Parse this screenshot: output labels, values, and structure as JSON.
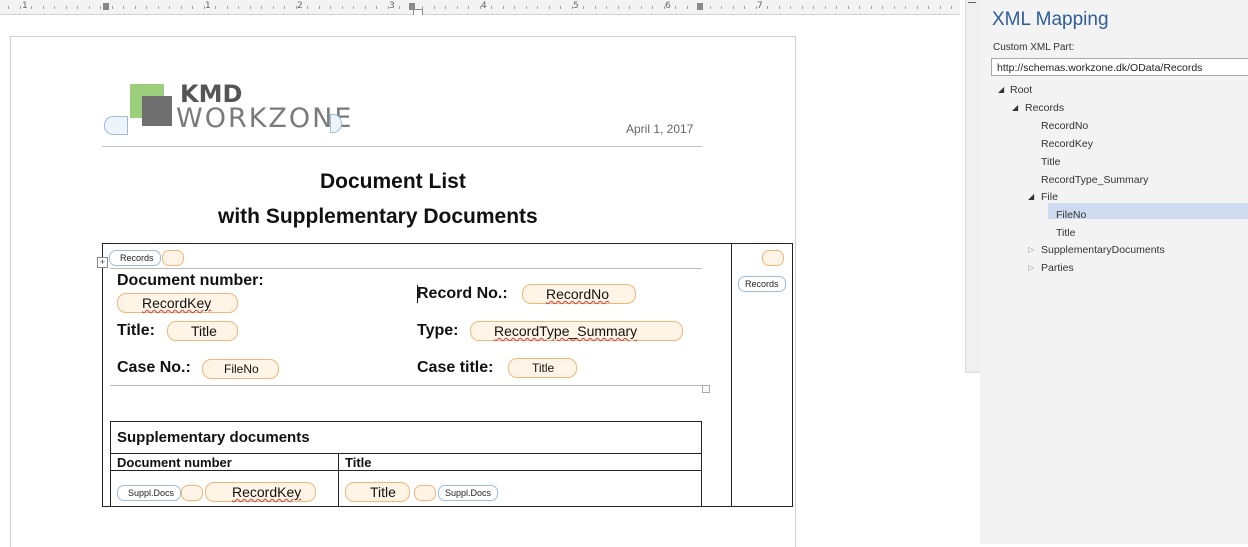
{
  "ruler": {
    "marks": [
      "1",
      "1",
      "2",
      "3",
      "4",
      "5",
      "6",
      "7"
    ]
  },
  "document": {
    "logo": {
      "top": "KMD",
      "bottom": "WORKZONE"
    },
    "date": "April 1, 2017",
    "title_line1": "Document List",
    "title_line2": "with Supplementary Documents",
    "records_tag": "Records",
    "records_tag_right": "Records",
    "fields": {
      "doc_number_label": "Document number:",
      "record_key": "RecordKey",
      "record_no_label": "Record No.:",
      "record_no": "RecordNo",
      "title_label": "Title:",
      "title": "Title",
      "type_label": "Type:",
      "type": "RecordType_Summary",
      "case_no_label": "Case No.:",
      "case_no": "FileNo",
      "case_title_label": "Case title:",
      "case_title": "Title"
    },
    "supp_table": {
      "heading": "Supplementary documents",
      "col1": "Document number",
      "col2": "Title",
      "suppl_tag_left": "Suppl.Docs",
      "suppl_tag_right": "Suppl.Docs",
      "row_record_key": "RecordKey",
      "row_title": "Title"
    }
  },
  "xml_pane": {
    "title": "XML Mapping",
    "custom_label": "Custom XML Part:",
    "custom_value": "http://schemas.workzone.dk/OData/Records",
    "tree": {
      "root": "Root",
      "records": "Records",
      "record_no": "RecordNo",
      "record_key": "RecordKey",
      "title": "Title",
      "record_type": "RecordType_Summary",
      "file": "File",
      "file_no": "FileNo",
      "file_title": "Title",
      "supp_docs": "SupplementaryDocuments",
      "parties": "Parties"
    }
  },
  "colors": {
    "pane_title": "#2e5d9a",
    "control_fill": "#fff4e5",
    "control_border": "#f0b77a",
    "selection": "#cfdcef",
    "logo_green": "#9bcf7b"
  }
}
